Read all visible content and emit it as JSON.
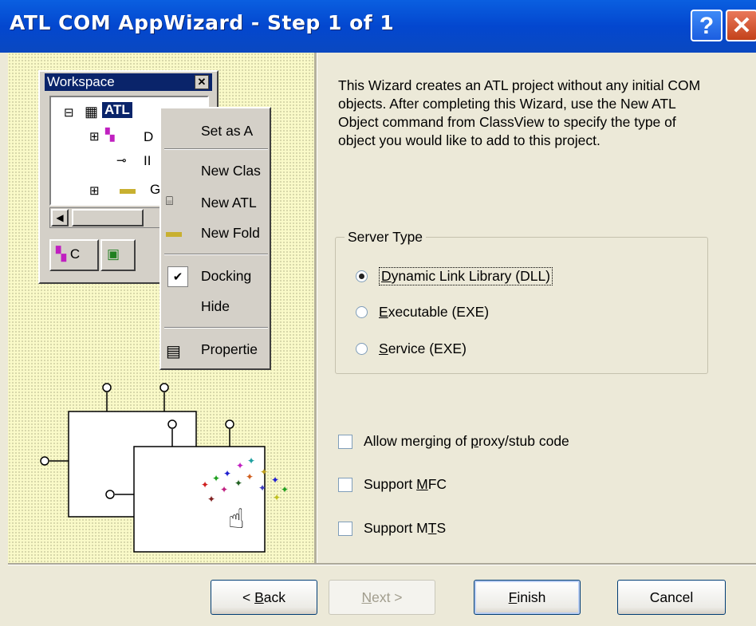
{
  "window": {
    "title": "ATL COM AppWizard - Step 1 of 1",
    "help_glyph": "?",
    "close_glyph": "✕"
  },
  "illustration": {
    "workspace_title": "Workspace",
    "workspace_close": "✕",
    "tree_root": "ATL",
    "tree_items": [
      "D",
      "II",
      "G"
    ],
    "tab_label": "C",
    "menu": [
      "Set as A",
      "New Clas",
      "New ATL",
      "New Fold",
      "Docking",
      "Hide",
      "Propertie"
    ]
  },
  "description": "This Wizard creates an ATL project without any initial COM objects. After completing this Wizard, use the New ATL Object command from ClassView to specify the type of object you would like to add to this project.",
  "server_type": {
    "label": "Server Type",
    "options": [
      {
        "pre": "",
        "key": "D",
        "post": "ynamic Link Library (DLL)",
        "selected": true
      },
      {
        "pre": "",
        "key": "E",
        "post": "xecutable (EXE)",
        "selected": false
      },
      {
        "pre": "",
        "key": "S",
        "post": "ervice (EXE)",
        "selected": false
      }
    ]
  },
  "checkboxes": [
    {
      "pre": "Allow merging of ",
      "key": "p",
      "post": "roxy/stub code",
      "checked": false
    },
    {
      "pre": "Support ",
      "key": "M",
      "post": "FC",
      "checked": false
    },
    {
      "pre": "Support M",
      "key": "T",
      "post": "S",
      "checked": false
    }
  ],
  "buttons": {
    "back": {
      "pre": "< ",
      "key": "B",
      "post": "ack"
    },
    "next": {
      "pre": "",
      "key": "N",
      "post": "ext >"
    },
    "finish": {
      "pre": "",
      "key": "F",
      "post": "inish"
    },
    "cancel": "Cancel"
  },
  "colors": {
    "titlebar": "#0347cf",
    "dialog_bg": "#ece9d8",
    "illustration_bg": "#fafac8"
  }
}
